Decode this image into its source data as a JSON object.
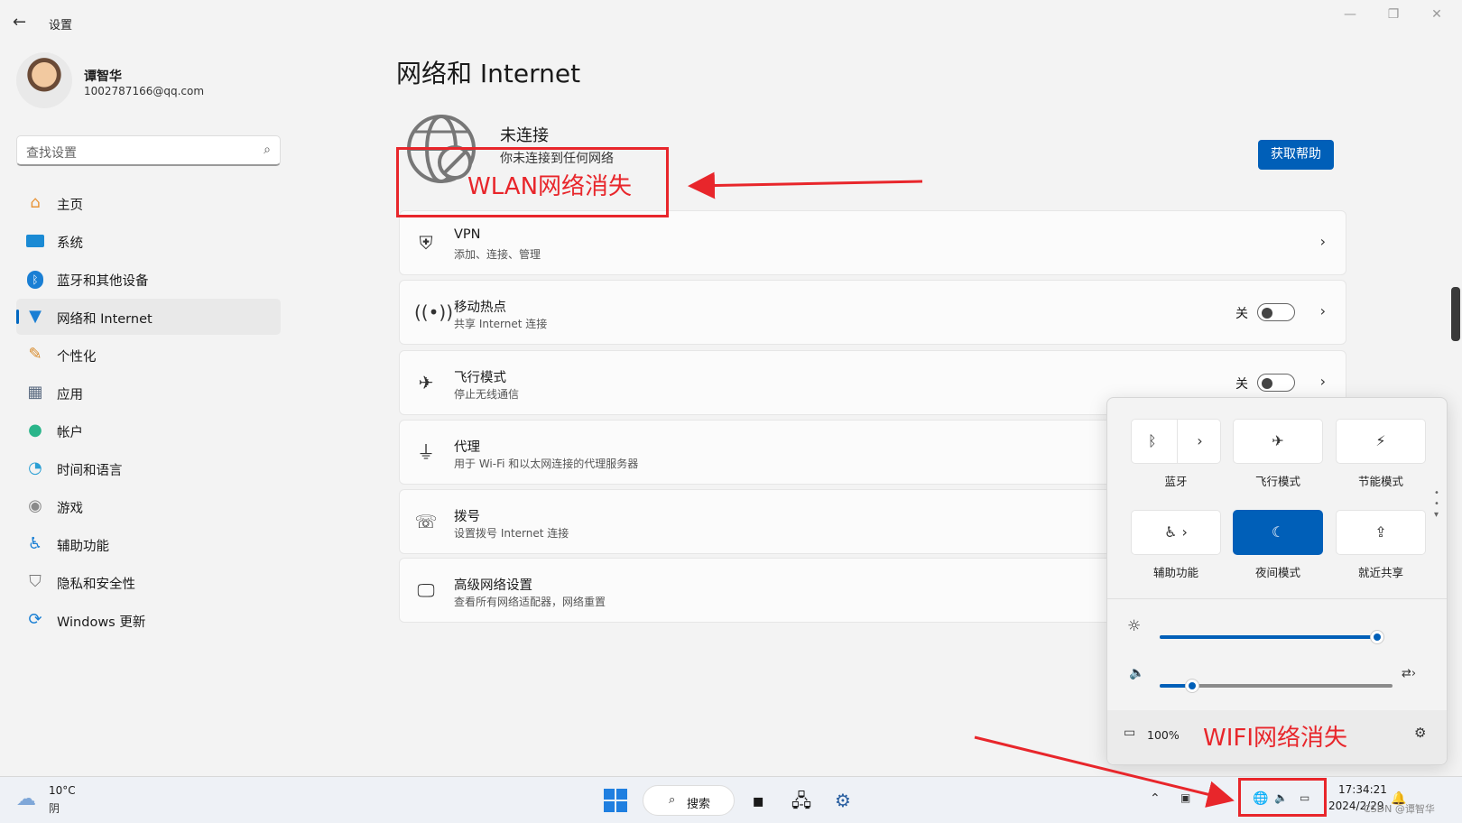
{
  "window": {
    "title": "设置",
    "back_icon": "back-arrow-icon"
  },
  "profile": {
    "name": "谭智华",
    "email": "1002787166@qq.com"
  },
  "search": {
    "placeholder": "查找设置"
  },
  "sidebar": {
    "items": [
      {
        "label": "主页",
        "icon": "home-icon"
      },
      {
        "label": "系统",
        "icon": "system-icon"
      },
      {
        "label": "蓝牙和其他设备",
        "icon": "bluetooth-icon"
      },
      {
        "label": "网络和 Internet",
        "icon": "network-icon",
        "active": true
      },
      {
        "label": "个性化",
        "icon": "brush-icon"
      },
      {
        "label": "应用",
        "icon": "apps-icon"
      },
      {
        "label": "帐户",
        "icon": "account-icon"
      },
      {
        "label": "时间和语言",
        "icon": "clock-globe-icon"
      },
      {
        "label": "游戏",
        "icon": "gamepad-icon"
      },
      {
        "label": "辅助功能",
        "icon": "accessibility-icon"
      },
      {
        "label": "隐私和安全性",
        "icon": "shield-icon"
      },
      {
        "label": "Windows 更新",
        "icon": "update-icon"
      }
    ]
  },
  "main": {
    "title": "网络和 Internet",
    "status": {
      "title": "未连接",
      "description": "你未连接到任何网络"
    },
    "help_button": "获取帮助",
    "cards": [
      {
        "title": "VPN",
        "subtitle": "添加、连接、管理",
        "icon": "vpn-shield-icon"
      },
      {
        "title": "移动热点",
        "subtitle": "共享 Internet 连接",
        "state": "关",
        "toggle": false,
        "icon": "hotspot-icon"
      },
      {
        "title": "飞行模式",
        "subtitle": "停止无线通信",
        "state": "关",
        "toggle": false,
        "icon": "airplane-icon"
      },
      {
        "title": "代理",
        "subtitle": "用于 Wi-Fi 和以太网连接的代理服务器",
        "icon": "proxy-icon"
      },
      {
        "title": "拨号",
        "subtitle": "设置拨号 Internet 连接",
        "icon": "dialup-icon"
      },
      {
        "title": "高级网络设置",
        "subtitle": "查看所有网络适配器，网络重置",
        "icon": "monitor-network-icon"
      }
    ]
  },
  "annotations": {
    "wlan": "WLAN网络消失",
    "wifi": "WIFI网络消失",
    "color": "#e8262b"
  },
  "quick_settings": {
    "tiles": [
      {
        "label": "蓝牙",
        "on": false
      },
      {
        "label": "飞行模式",
        "on": false
      },
      {
        "label": "节能模式",
        "on": false
      },
      {
        "label": "辅助功能",
        "on": false
      },
      {
        "label": "夜间模式",
        "on": true
      },
      {
        "label": "就近共享",
        "on": false
      }
    ],
    "brightness_level": 0.97,
    "volume_level": 0.14,
    "battery": "100%"
  },
  "taskbar": {
    "weather_temp": "10°C",
    "weather_condition": "阴",
    "search_label": "搜索",
    "time": "17:34:21",
    "date": "2024/2/29",
    "watermark": "CSDN @谭智华"
  },
  "colors": {
    "accent": "#005fb8",
    "annotation": "#e8262b"
  }
}
